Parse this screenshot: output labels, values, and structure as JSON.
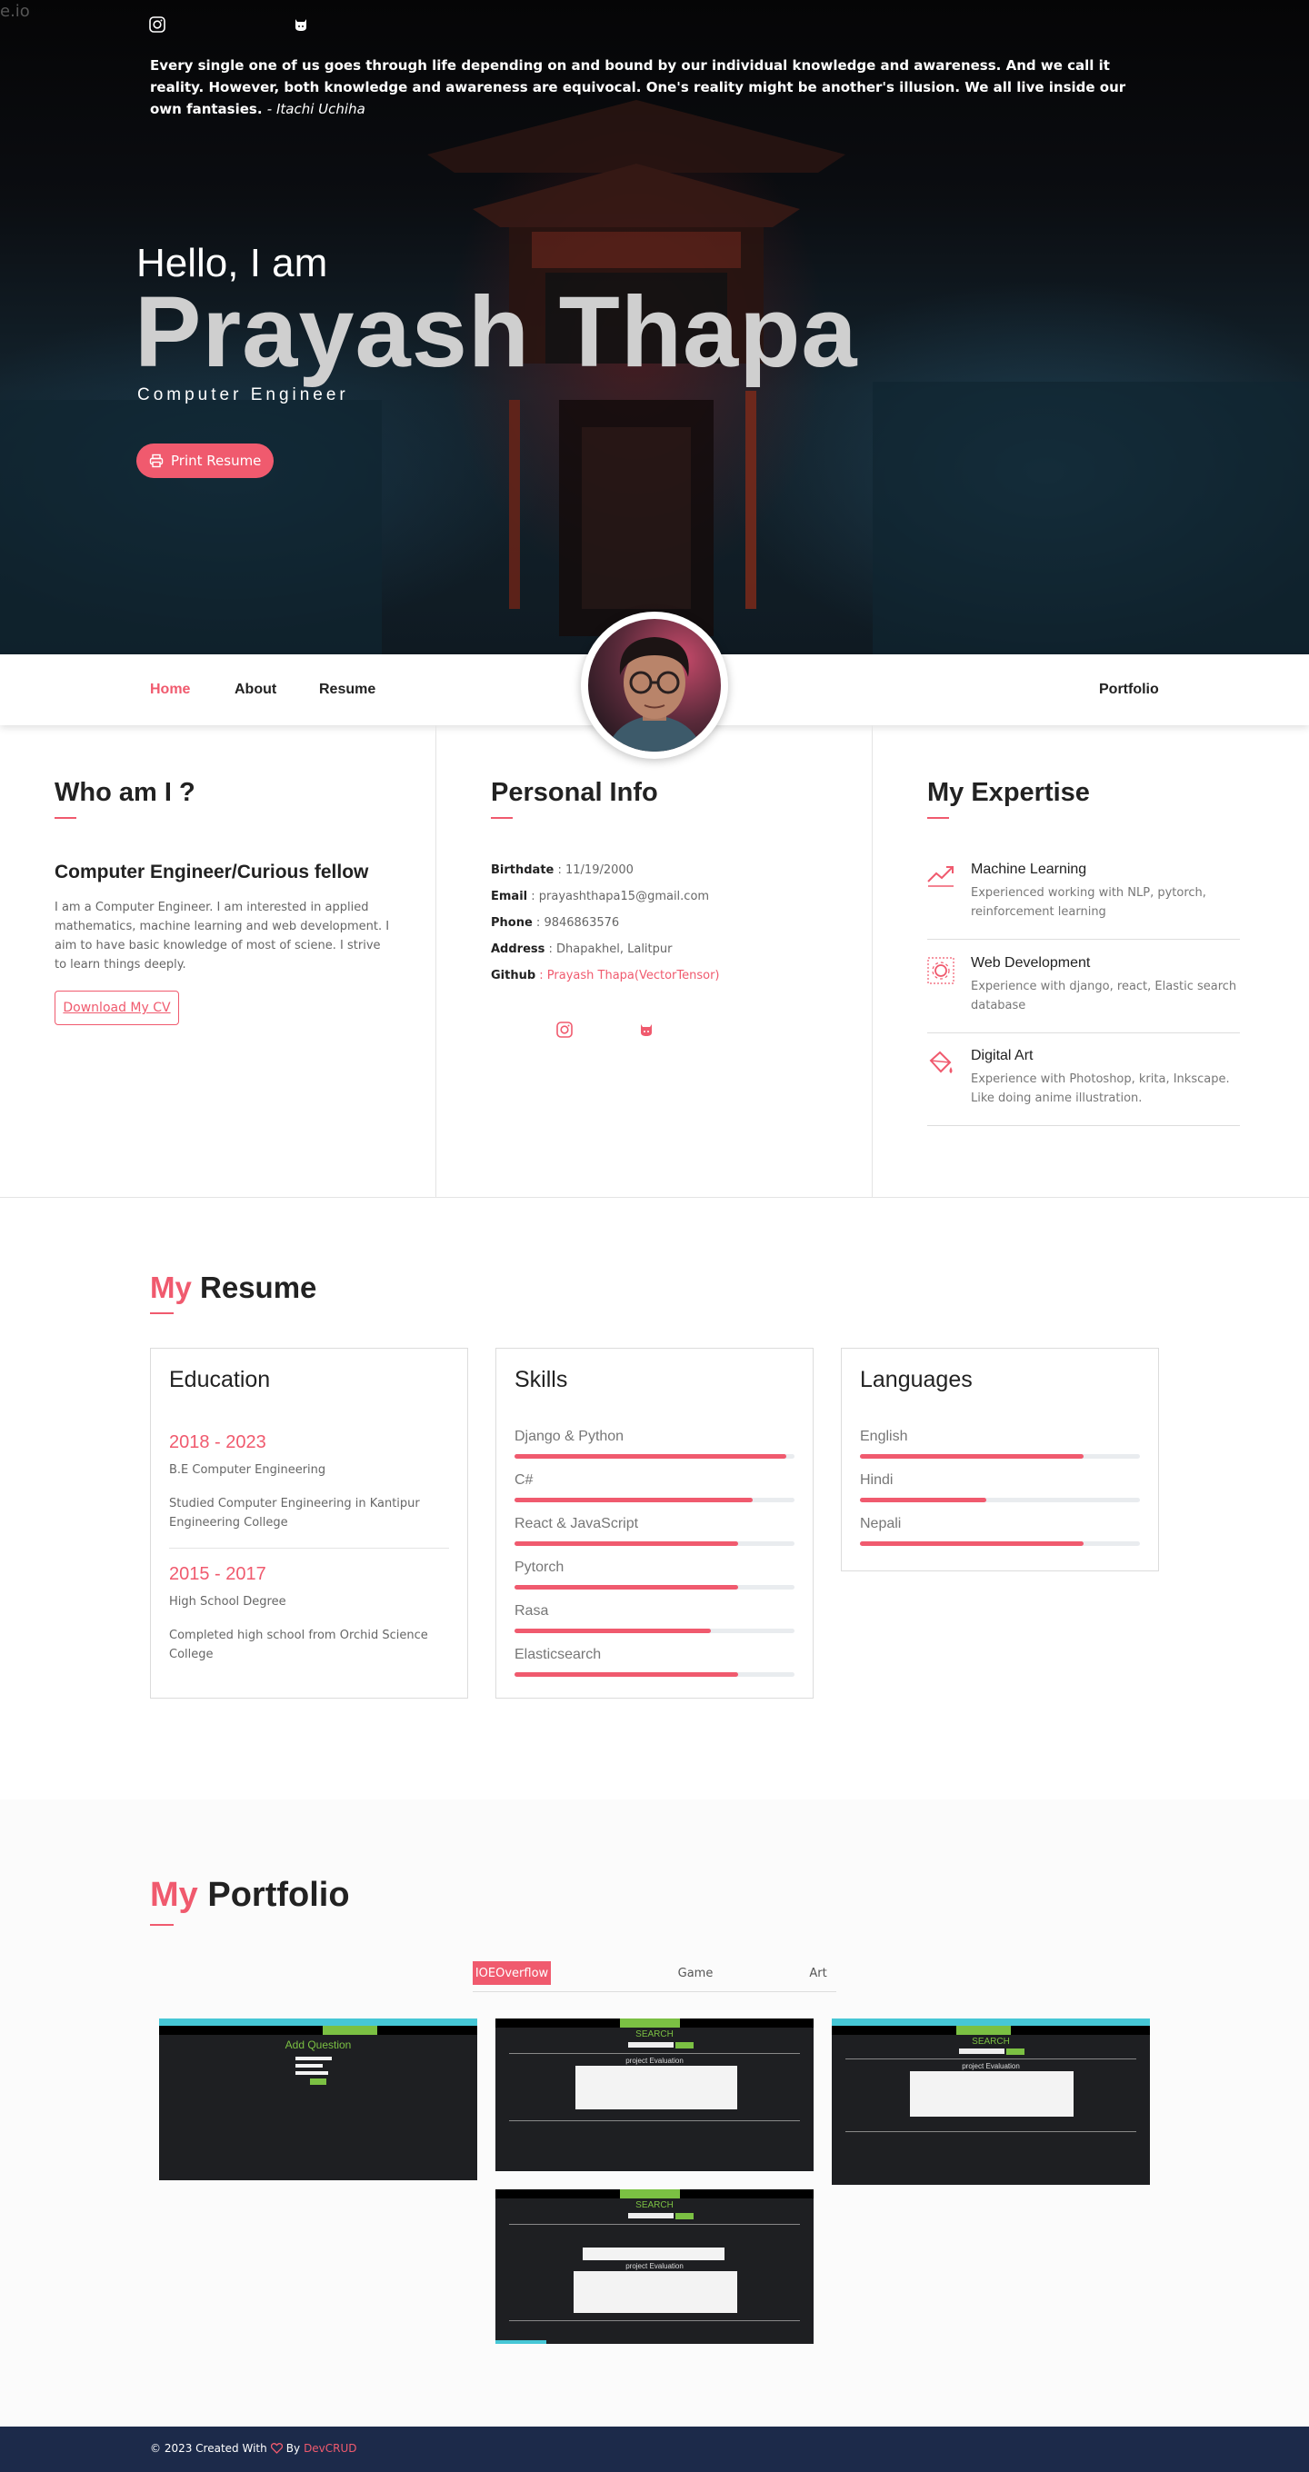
{
  "corner": "e.io",
  "hero": {
    "quote": "Every single one of us goes through life depending on and bound by our individual knowledge and awareness. And we call it reality. However, both knowledge and awareness are equivocal. One's reality might be another's illusion. We all live inside our own fantasies.",
    "quote_author": "- Itachi Uchiha",
    "greeting": "Hello, I am",
    "name": "Prayash Thapa",
    "role": "Computer Engineer",
    "print_button": "Print Resume",
    "icons": [
      "instagram-icon",
      "github-icon"
    ]
  },
  "nav": {
    "items": [
      "Home",
      "About",
      "Resume"
    ],
    "right": "Portfolio",
    "active": "Home"
  },
  "about": {
    "title": "Who am I ?",
    "subtitle": "Computer Engineer/Curious fellow",
    "text": "I am a Computer Engineer. I am interested in applied mathematics, machine learning and web development. I aim to have basic knowledge of most of sciene. I strive to learn things deeply.",
    "cv_button": "Download My CV"
  },
  "personal": {
    "title": "Personal Info",
    "rows": [
      {
        "label": "Birthdate",
        "value": " : 11/19/2000"
      },
      {
        "label": "Email",
        "value": " : prayashthapa15@gmail.com"
      },
      {
        "label": "Phone",
        "value": " : 9846863576"
      },
      {
        "label": "Address",
        "value": " : Dhapakhel, Lalitpur"
      },
      {
        "label": "Github",
        "value": " : Prayash Thapa(VectorTensor)"
      }
    ]
  },
  "expertise": {
    "title": "My Expertise",
    "items": [
      {
        "title": "Machine Learning",
        "desc": "Experienced working with NLP, pytorch, reinforcement learning",
        "icon": "trending-up-icon"
      },
      {
        "title": "Web Development",
        "desc": "Experience with django, react, Elastic search database",
        "icon": "gear-icon"
      },
      {
        "title": "Digital Art",
        "desc": "Experience with Photoshop, krita, Inkscape. Like doing anime illustration.",
        "icon": "paint-bucket-icon"
      }
    ]
  },
  "resume": {
    "title_accent": "My",
    "title_rest": " Resume",
    "education": {
      "title": "Education",
      "entries": [
        {
          "years": "2018 - 2023",
          "degree": "B.E Computer Engineering",
          "desc": "Studied Computer Engineering in Kantipur Engineering College"
        },
        {
          "years": "2015 - 2017",
          "degree": "High School Degree",
          "desc": "Completed high school from Orchid Science College"
        }
      ]
    },
    "skills": {
      "title": "Skills",
      "items": [
        {
          "name": "Django & Python",
          "level": 0.97
        },
        {
          "name": "C#",
          "level": 0.85
        },
        {
          "name": "React & JavaScript",
          "level": 0.8
        },
        {
          "name": "Pytorch",
          "level": 0.8
        },
        {
          "name": "Rasa",
          "level": 0.7
        },
        {
          "name": "Elasticsearch",
          "level": 0.8
        }
      ]
    },
    "languages": {
      "title": "Languages",
      "items": [
        {
          "name": "English",
          "level": 0.8
        },
        {
          "name": "Hindi",
          "level": 0.45
        },
        {
          "name": "Nepali",
          "level": 0.8
        }
      ]
    }
  },
  "portfolio": {
    "title_accent": "My",
    "title_rest": " Portfolio",
    "filters": [
      "IOEOverflow",
      "Game",
      "Art"
    ],
    "active_filter": "IOEOverflow",
    "shots": [
      {
        "heading": "Add Question"
      },
      {
        "heading": "SEARCH",
        "caption": "project Evaluation"
      },
      {
        "heading": "SEARCH",
        "caption": "project Evaluation"
      },
      {
        "heading": "SEARCH",
        "caption": "project Evaluation"
      }
    ]
  },
  "footer": {
    "prefix": "© 2023 Created With",
    "by": "By",
    "brand": "DevCRUD"
  },
  "colors": {
    "accent": "#f05a6e",
    "footer": "#1c2a4a"
  }
}
